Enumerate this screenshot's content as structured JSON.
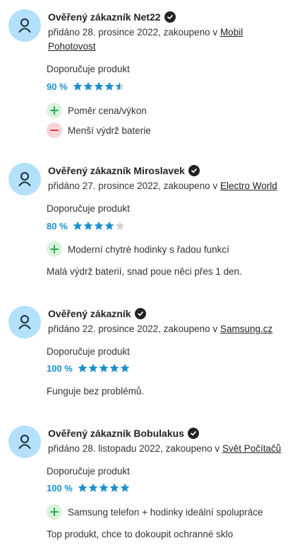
{
  "reviews": [
    {
      "name": "Ověřený zákazník Net22",
      "meta_prefix": "přidáno 28. prosince 2022, zakoupeno v ",
      "shop": "Mobil Pohotovost",
      "recommend_label": "Doporučuje produkt",
      "rating_percent": "90 %",
      "stars": 4.5,
      "pros": [
        "Poměr cena/výkon"
      ],
      "cons": [
        "Menší výdrž baterie"
      ],
      "comment": ""
    },
    {
      "name": "Ověřený zákazník Miroslavek",
      "meta_prefix": "přidáno 27. prosince 2022, zakoupeno v ",
      "shop": "Electro World",
      "recommend_label": "Doporučuje produkt",
      "rating_percent": "80 %",
      "stars": 4,
      "pros": [
        "Moderní chytré hodinky s řadou funkcí"
      ],
      "cons": [],
      "comment": "Malá výdrž baterií, snad poue něci přes 1 den."
    },
    {
      "name": "Ověřený zákazník",
      "meta_prefix": "přidáno 22. prosince 2022, zakoupeno v ",
      "shop": "Samsung.cz",
      "recommend_label": "Doporučuje produkt",
      "rating_percent": "100 %",
      "stars": 5,
      "pros": [],
      "cons": [],
      "comment": "Funguje bez problémů."
    },
    {
      "name": "Ověřený zákazník Bobulakus",
      "meta_prefix": "přidáno 28. listopadu 2022, zakoupeno v ",
      "shop": "Svět Počítačů",
      "recommend_label": "Doporučuje produkt",
      "rating_percent": "100 %",
      "stars": 5,
      "pros": [
        "Samsung telefon + hodinky ideální spolupráce"
      ],
      "cons": [],
      "comment": "Top produkt, chce to dokoupit ochranné sklo"
    }
  ],
  "icons": {
    "avatar": "user-icon",
    "verified": "check-icon",
    "pro": "plus-icon",
    "con": "minus-icon",
    "star": "star-icon"
  },
  "colors": {
    "avatar_bg": "#b3e1fb",
    "rating_blue": "#1b8fd1",
    "star_empty": "#d0d0d0",
    "pro_bg": "#d8f2dd",
    "pro_fg": "#2fa84f",
    "con_bg": "#f8d4d8",
    "con_fg": "#d9364a"
  }
}
